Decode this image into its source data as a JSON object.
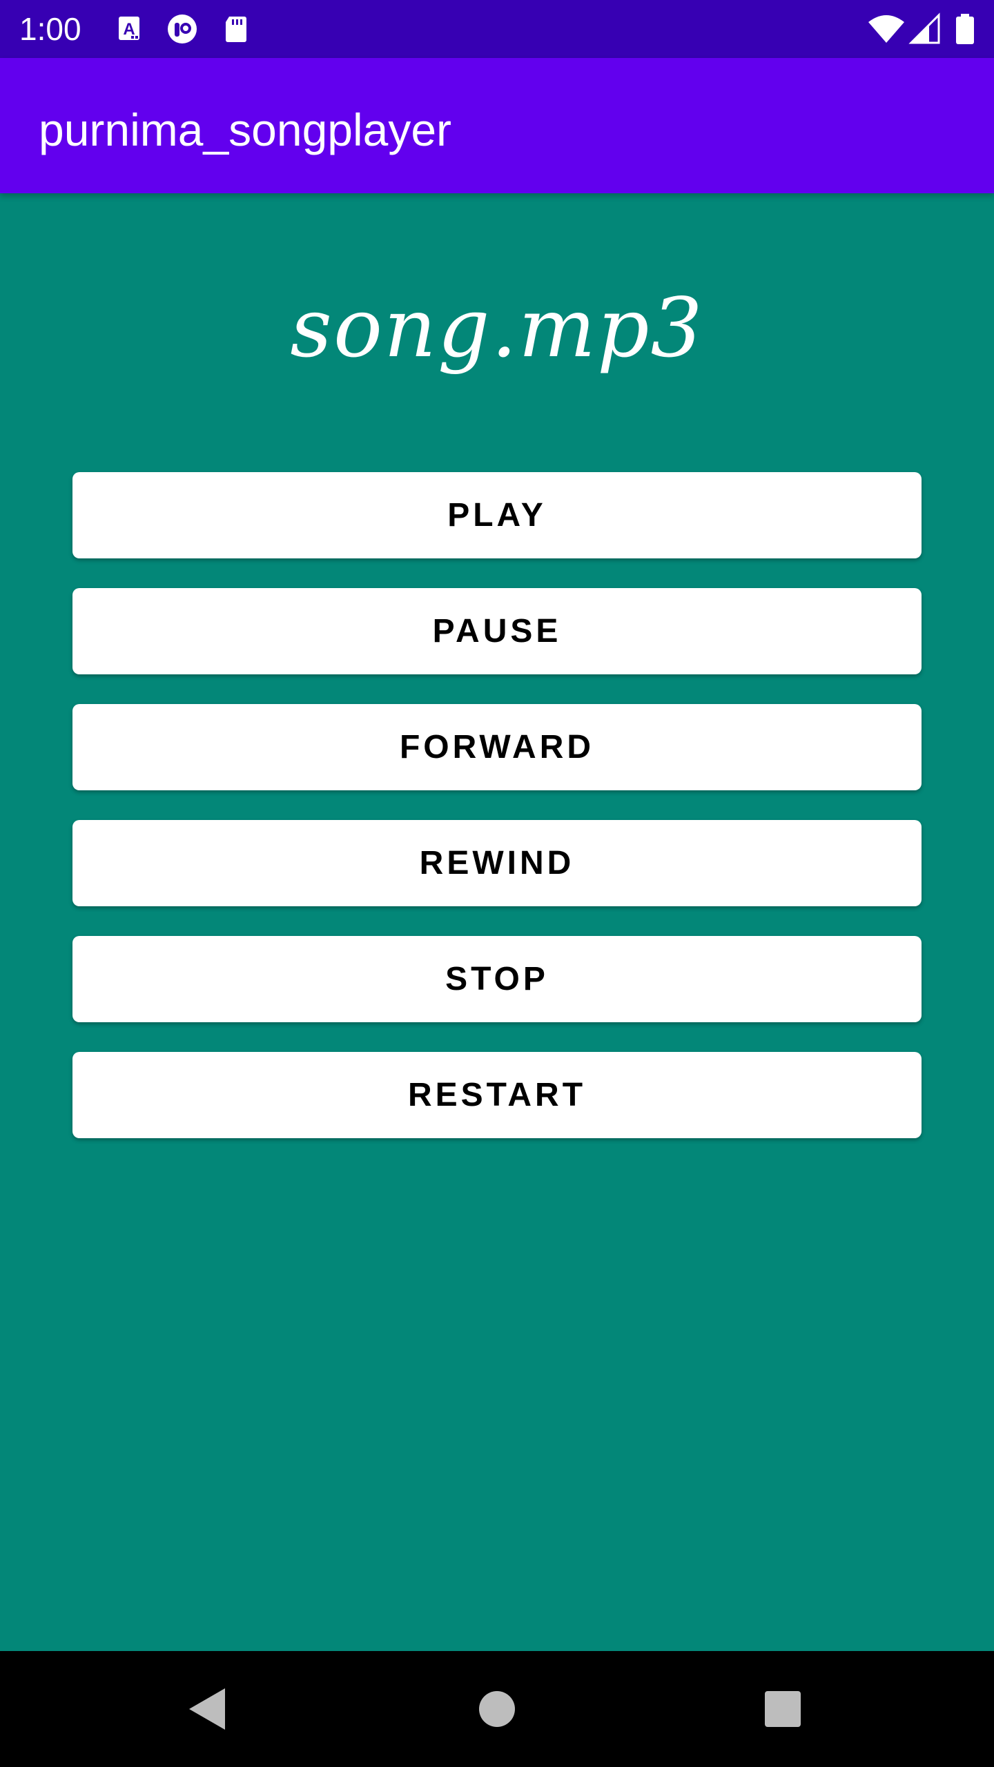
{
  "status_bar": {
    "time": "1:00",
    "left_icons": [
      "a-accessibility-icon",
      "headset-circle-icon",
      "sd-card-icon"
    ],
    "right_icons": [
      "wifi-icon",
      "signal-icon",
      "battery-icon"
    ],
    "background": "#3700B3"
  },
  "app_bar": {
    "title": "purnima_songplayer",
    "background": "#6200EE"
  },
  "main": {
    "background": "#038778",
    "song_title": "song.mp3",
    "buttons": [
      {
        "label": "PLAY"
      },
      {
        "label": "PAUSE"
      },
      {
        "label": "FORWARD"
      },
      {
        "label": "REWIND"
      },
      {
        "label": "STOP"
      },
      {
        "label": "RESTART"
      }
    ]
  },
  "nav_bar": {
    "icons": [
      "back-icon",
      "home-icon",
      "recents-icon"
    ]
  }
}
